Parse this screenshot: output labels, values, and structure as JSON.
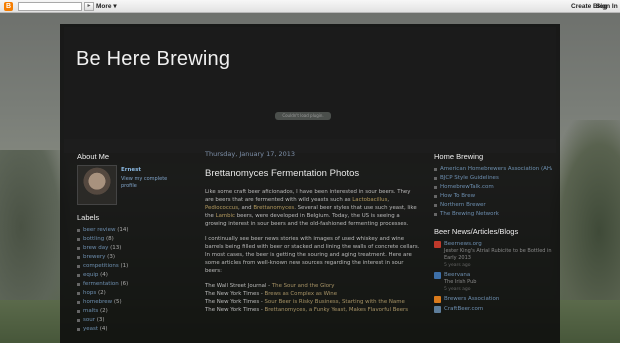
{
  "navbar": {
    "logo": "B",
    "go": "▸",
    "more_label": "More ▾",
    "create_blog_label": "Create Blog",
    "sign_in_label": "Sign In"
  },
  "blog": {
    "title": "Be Here Brewing",
    "badge": "Couldn't load plugin."
  },
  "about": {
    "heading": "About Me",
    "name": "Ernest",
    "profile_link": "View my complete profile"
  },
  "labels": {
    "heading": "Labels",
    "items": [
      {
        "name": "beer review",
        "count": "(14)"
      },
      {
        "name": "bottling",
        "count": "(8)"
      },
      {
        "name": "brew day",
        "count": "(13)"
      },
      {
        "name": "brewery",
        "count": "(3)"
      },
      {
        "name": "competitions",
        "count": "(1)"
      },
      {
        "name": "equip",
        "count": "(4)"
      },
      {
        "name": "fermentation",
        "count": "(6)"
      },
      {
        "name": "hops",
        "count": "(2)"
      },
      {
        "name": "homebrew",
        "count": "(5)"
      },
      {
        "name": "malts",
        "count": "(2)"
      },
      {
        "name": "sour",
        "count": "(3)"
      },
      {
        "name": "yeast",
        "count": "(4)"
      }
    ]
  },
  "post": {
    "date": "Thursday, January 17, 2013",
    "title": "Brettanomyces Fermentation Photos",
    "p1": {
      "a": "Like some craft beer aficionados, I have been interested in sour beers. They are beers that are fermented with wild yeasts such as ",
      "h1": "Lactobacillus",
      "b": ", ",
      "h2": "Pediococcus",
      "c": ", and ",
      "h3": "Brettanomyces",
      "d": ". Several beer styles that use such yeast, like the ",
      "h4": "Lambic",
      "e": " beers, were developed in Belgium. Today, the US is seeing a growing interest in sour beers and the old-fashioned fermenting processes."
    },
    "p2": "I continually see beer news stories with images of used whiskey and wine barrels being filled with beer or stacked and lining the walls of concrete cellars. In most cases, the beer is getting the souring and aging treatment. Here are some articles from well-known new sources regarding the interest in sour beers:",
    "links": [
      {
        "source": "The Wall Street Journal - ",
        "title": "The Sour and the Glory"
      },
      {
        "source": "The New York Times - ",
        "title": "Brews as Complex as Wine"
      },
      {
        "source": "The New York Times - ",
        "title": "Sour Beer is Risky Business, Starting with the Name"
      },
      {
        "source": "The New York Times - ",
        "title": "Brettanomyces, a Funky Yeast, Makes Flavorful Beers"
      }
    ]
  },
  "home_brewing": {
    "heading": "Home Brewing",
    "items": [
      "American Homebrewers Association (AHA)",
      "BJCP Style Guidelines",
      "HomebrewTalk.com",
      "How To Brew",
      "Northern Brewer",
      "The Brewing Network"
    ]
  },
  "beer_news": {
    "heading": "Beer News/Articles/Blogs",
    "feeds": [
      {
        "name": "Beernews.org",
        "post": "Jester King's Atrial Rubicite to be Bottled in Early 2013",
        "age": "5 years ago",
        "color": "#c0392b"
      },
      {
        "name": "Beervana",
        "post": "The Irish Pub",
        "age": "5 years ago",
        "color": "#3d6fa8"
      },
      {
        "name": "Brewers Association",
        "post": "",
        "age": "",
        "color": "#d97a1c"
      },
      {
        "name": "CraftBeer.com",
        "post": "",
        "age": "",
        "color": "#5d7d9a"
      }
    ]
  }
}
